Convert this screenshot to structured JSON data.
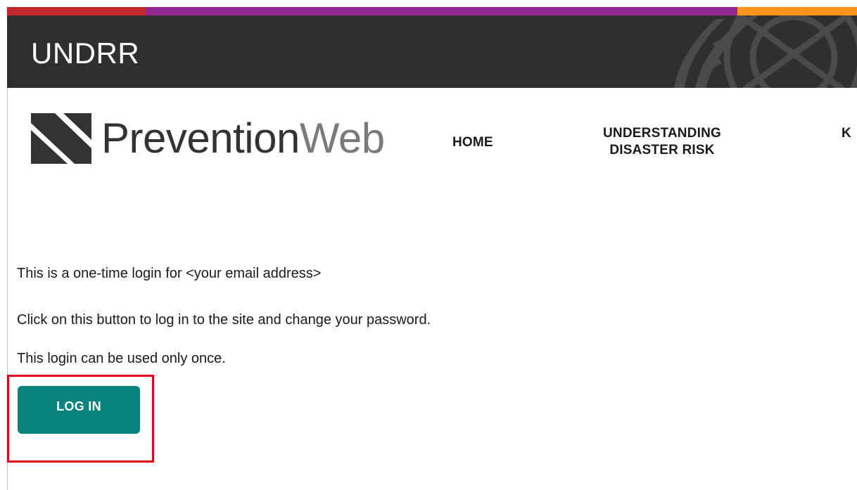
{
  "colors": {
    "strip": [
      "#c1272d",
      "#92278f",
      "#f7941d"
    ],
    "header_bg": "#2f2f2f",
    "button_bg": "#0a8380",
    "highlight": "#e3001b"
  },
  "header": {
    "brand": "UNDRR"
  },
  "logo": {
    "text_bold": "Prevention",
    "text_light": "Web"
  },
  "nav": {
    "items": [
      {
        "label": "HOME"
      },
      {
        "label_line1": "UNDERSTANDING",
        "label_line2": "DISASTER RISK"
      },
      {
        "label": "K"
      }
    ]
  },
  "content": {
    "line1_prefix": "This is a one-time login for ",
    "line1_email": "<your email address>",
    "line2": "Click on this button to log in to the site and change your password.",
    "line3": "This login can be used only once.",
    "login_button": "LOG IN"
  }
}
